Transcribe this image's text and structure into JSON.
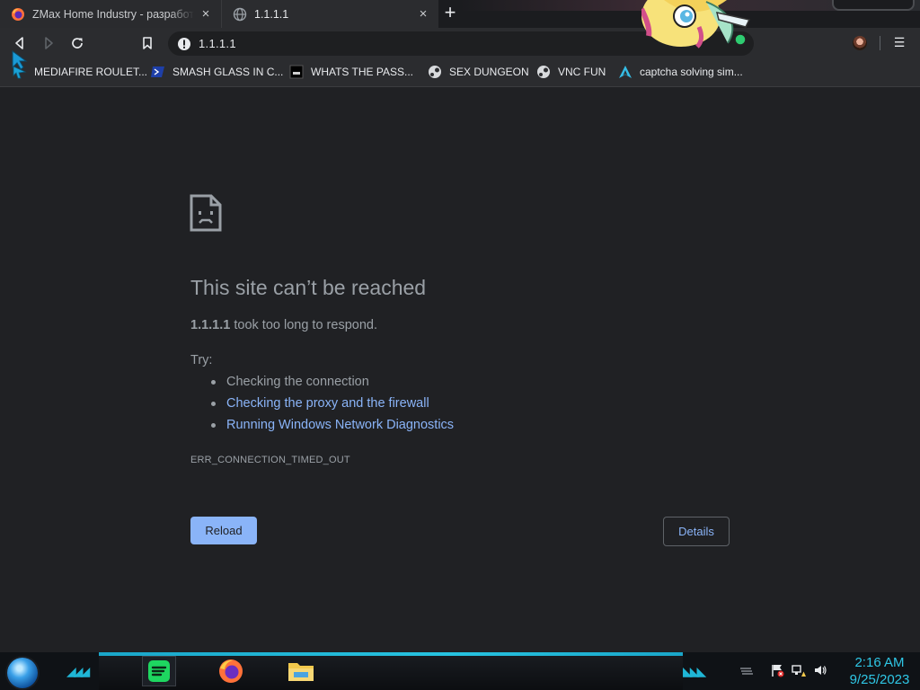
{
  "tabs": [
    {
      "title": "ZMax Home Industry - разработка",
      "favicon": "firefox-icon"
    },
    {
      "title": "1.1.1.1",
      "favicon": "globe-icon"
    }
  ],
  "toolbar": {
    "url": "1.1.1.1",
    "security_icon": "info-icon"
  },
  "bookmarks": [
    {
      "label": "MEDIAFIRE ROULET...",
      "icon": "mediafire-icon"
    },
    {
      "label": "SMASH GLASS IN C...",
      "icon": "powershell-icon"
    },
    {
      "label": "WHATS THE PASS...",
      "icon": "terminal-icon"
    },
    {
      "label": "SEX DUNGEON",
      "icon": "steam-icon"
    },
    {
      "label": "VNC FUN",
      "icon": "steam-icon"
    },
    {
      "label": "captcha solving sim...",
      "icon": "arch-icon"
    }
  ],
  "error_page": {
    "heading": "This site can’t be reached",
    "host": "1.1.1.1",
    "summary_rest": " took too long to respond.",
    "try_label": "Try:",
    "suggestions": [
      "Checking the connection",
      "Checking the proxy and the firewall",
      "Running Windows Network Diagnostics"
    ],
    "error_code": "ERR_CONNECTION_TIMED_OUT",
    "reload_label": "Reload",
    "details_label": "Details"
  },
  "taskbar": {
    "time": "2:16 AM",
    "date": "9/25/2023",
    "apps": [
      "spotify-icon",
      "firefox-icon",
      "file-explorer-icon"
    ]
  },
  "colors": {
    "page_bg": "#202124",
    "link": "#8ab4f8",
    "text_secondary": "#9aa0a6",
    "taskbar_accent": "#1fb6d6"
  }
}
